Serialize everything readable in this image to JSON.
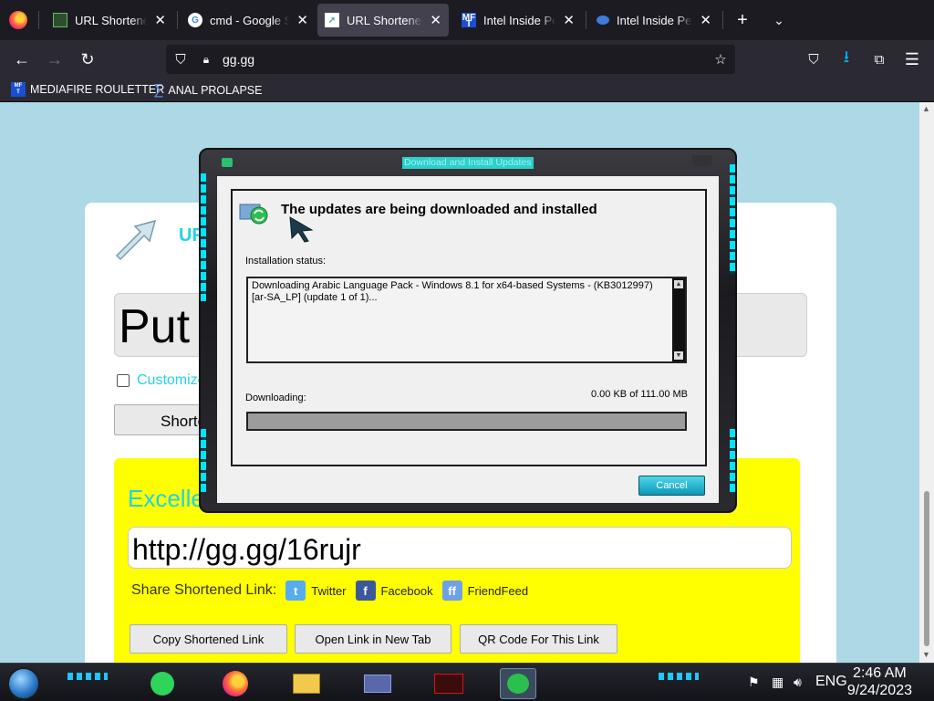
{
  "browser": {
    "tabs": [
      {
        "label": "URL Shortener, Br",
        "favicon": "dark-tab-icon",
        "active": false
      },
      {
        "label": "cmd - Google Sea",
        "favicon": "google-icon",
        "active": false
      },
      {
        "label": "URL Shortener - ",
        "favicon": "arrow-tab-icon",
        "active": true
      },
      {
        "label": "Intel Inside Penti",
        "favicon": "mft-icon",
        "active": false
      },
      {
        "label": "Intel Inside Penti",
        "favicon": "blue-eye-icon",
        "active": false
      }
    ],
    "url": "gg.gg",
    "bookmarks": [
      {
        "label": "MEDIAFIRE ROULETTER",
        "icon": "mft-icon"
      },
      {
        "label": "ANAL PROLAPSE",
        "icon": "sigma-icon"
      }
    ]
  },
  "page": {
    "site_title": "URL",
    "input_text": "Put",
    "customize_label": "Customize",
    "shorten_button": "Shorte",
    "excellent_text": "Excelle",
    "short_link": "http://gg.gg/16rujr",
    "share_label": "Share Shortened Link:",
    "share_links": [
      {
        "label": "Twitter",
        "color": "#55acee"
      },
      {
        "label": "Facebook",
        "color": "#3b5998"
      },
      {
        "label": "FriendFeed",
        "color": "#6fa0e8"
      }
    ],
    "buttons": {
      "copy": "Copy Shortened Link",
      "open": "Open Link in New Tab",
      "qr": "QR Code For This Link"
    }
  },
  "dialog": {
    "title": "Download and Install Updates",
    "heading": "The updates are being downloaded and installed",
    "install_status_label": "Installation status:",
    "status_text": "Downloading Arabic Language Pack - Windows 8.1 for x64-based Systems - (KB3012997) [ar-SA_LP] (update 1 of 1)...",
    "downloading_label": "Downloading:",
    "download_size": "0.00 KB of 111.00 MB",
    "progress": 0,
    "cancel_label": "Cancel"
  },
  "taskbar": {
    "language": "ENG",
    "time": "2:46 AM",
    "date": "9/24/2023"
  },
  "colors": {
    "accent_cyan": "#21d3e3",
    "page_bg": "#add8e6",
    "yellow_panel": "#ffff00",
    "firefox_toolbar": "#2b2a33"
  }
}
